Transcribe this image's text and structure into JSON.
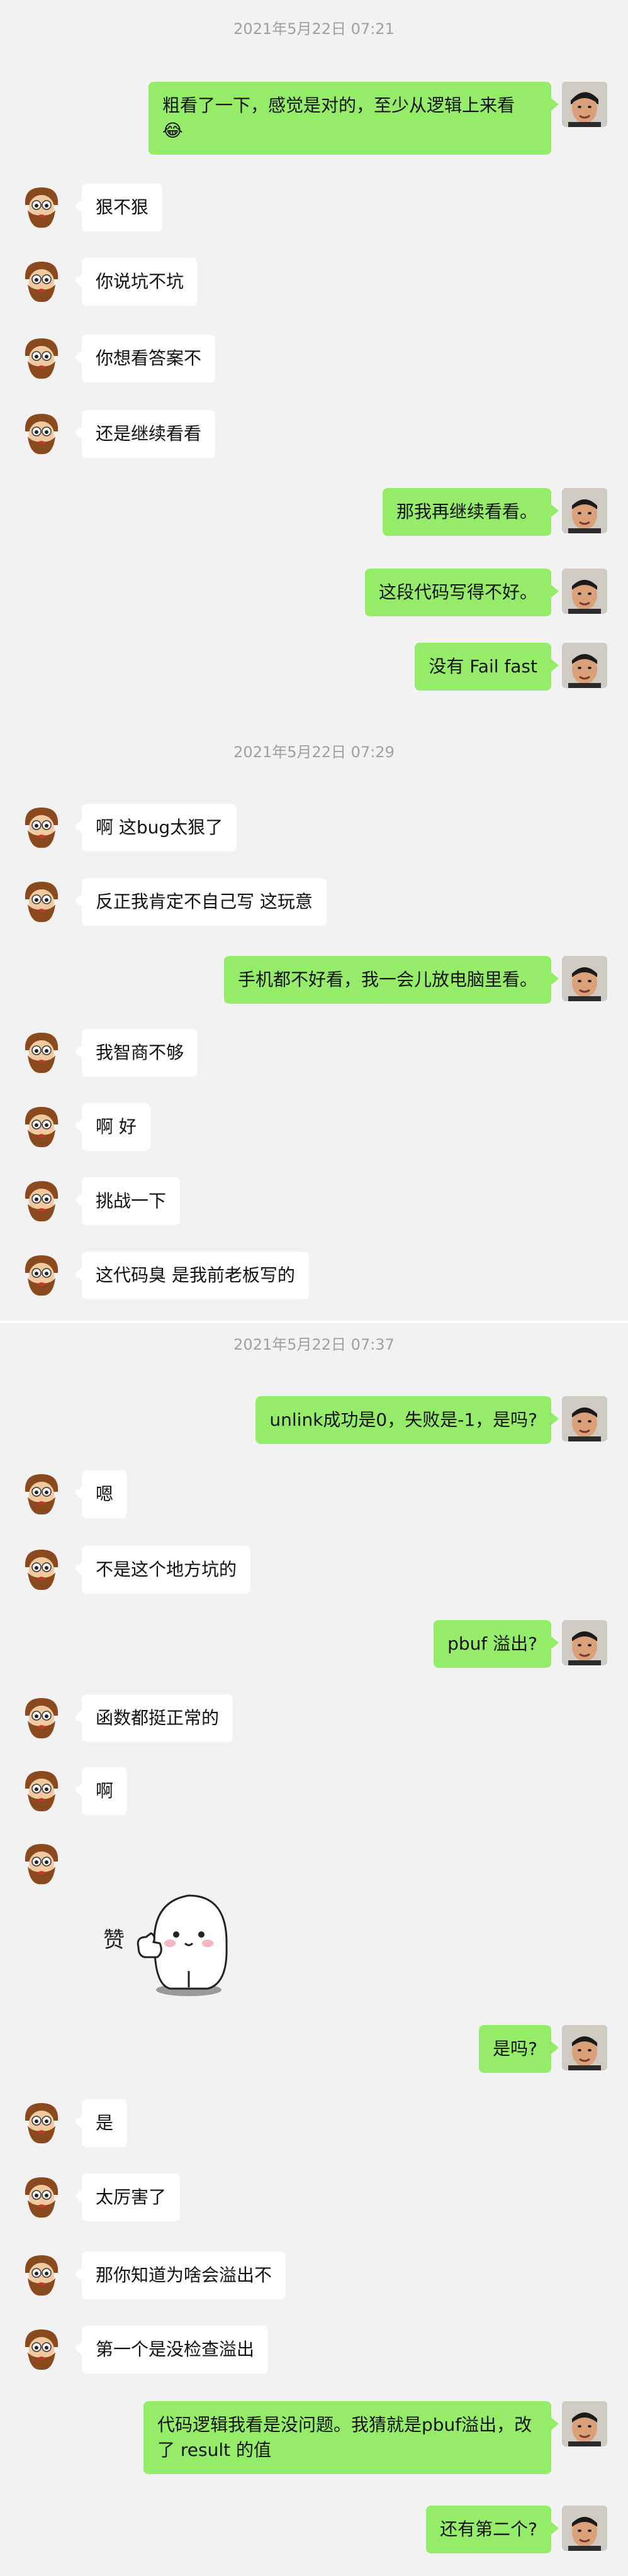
{
  "sections": [
    {
      "timestamp": "2021年5月22日 07:21",
      "messages": [
        {
          "side": "right",
          "text": "粗看了一下，感觉是对的，至少从逻辑上来看",
          "emoji": "😂"
        },
        {
          "side": "left",
          "text": "狠不狠"
        },
        {
          "side": "left",
          "text": "你说坑不坑"
        },
        {
          "side": "left",
          "text": "你想看答案不"
        },
        {
          "side": "left",
          "text": "还是继续看看"
        },
        {
          "side": "right",
          "text": "那我再继续看看。"
        },
        {
          "side": "right",
          "text": "这段代码写得不好。"
        },
        {
          "side": "right",
          "text": "没有 Fail fast"
        }
      ]
    },
    {
      "timestamp": "2021年5月22日 07:29",
      "messages": [
        {
          "side": "left",
          "text": "啊 这bug太狠了"
        },
        {
          "side": "left",
          "text": "反正我肯定不自己写 这玩意"
        },
        {
          "side": "right",
          "text": "手机都不好看，我一会儿放电脑里看。"
        },
        {
          "side": "left",
          "text": "我智商不够"
        },
        {
          "side": "left",
          "text": "啊 好"
        },
        {
          "side": "left",
          "text": "挑战一下"
        },
        {
          "side": "left",
          "text": "这代码臭 是我前老板写的"
        }
      ]
    },
    {
      "timestamp": "2021年5月22日 07:37",
      "messages": [
        {
          "side": "right",
          "text": "unlink成功是0，失败是-1，是吗?"
        },
        {
          "side": "left",
          "text": "嗯"
        },
        {
          "side": "left",
          "text": "不是这个地方坑的"
        },
        {
          "side": "right",
          "text": "pbuf 溢出?"
        },
        {
          "side": "left",
          "text": "函数都挺正常的"
        },
        {
          "side": "left",
          "text": "啊"
        },
        {
          "side": "left",
          "sticker": true,
          "sticker_text": "赞"
        },
        {
          "side": "right",
          "text": "是吗?"
        },
        {
          "side": "left",
          "text": "是"
        },
        {
          "side": "left",
          "text": "太厉害了"
        },
        {
          "side": "left",
          "text": "那你知道为啥会溢出不"
        },
        {
          "side": "left",
          "text": "第一个是没检查溢出"
        },
        {
          "side": "right",
          "text": "代码逻辑我看是没问题。我猜就是pbuf溢出，改了 result 的值"
        },
        {
          "side": "right",
          "text": "还有第二个?"
        }
      ]
    }
  ]
}
